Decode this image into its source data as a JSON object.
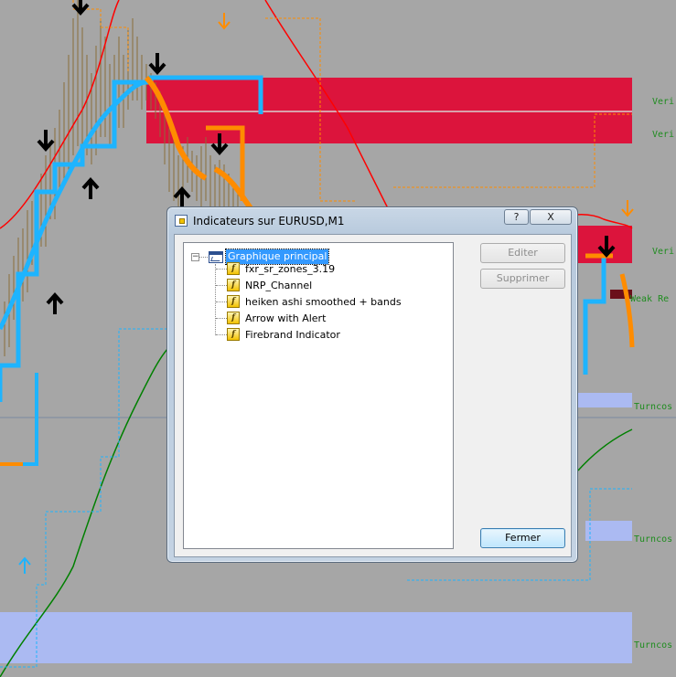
{
  "dialog": {
    "title": "Indicateurs sur EURUSD,M1",
    "help_label": "?",
    "close_label": "X",
    "tree": {
      "root_label": "Graphique principal",
      "expander": "−",
      "items": [
        {
          "label": "fxr_sr_zones_3.19"
        },
        {
          "label": "NRP_Channel"
        },
        {
          "label": "heiken ashi smoothed + bands"
        },
        {
          "label": "Arrow with Alert"
        },
        {
          "label": "Firebrand Indicator"
        }
      ],
      "item_icon": "f"
    },
    "buttons": {
      "edit": "Editer",
      "delete": "Supprimer",
      "close": "Fermer"
    }
  },
  "chart_labels": {
    "verified_1": "Veri",
    "verified_2": "Veri",
    "verified_3": "Veri",
    "weak": "Weak Re",
    "turncoat_1": "Turncos",
    "turncoat_2": "Turncos",
    "turncoat_3": "Turncos"
  },
  "colors": {
    "background": "#a6a6a6",
    "resistance_zone": "#dc143c",
    "support_zone": "#abbaf2",
    "channel_blue": "#1eb4ff",
    "heiken_orange": "#ff8c00",
    "signal_arrow": "#000000",
    "line_red": "#ff0000",
    "line_green": "#008000"
  },
  "icons": [
    "arrow-down-icon",
    "arrow-up-icon",
    "chart-window-icon",
    "indicator-fx-icon",
    "help-icon",
    "close-icon"
  ]
}
